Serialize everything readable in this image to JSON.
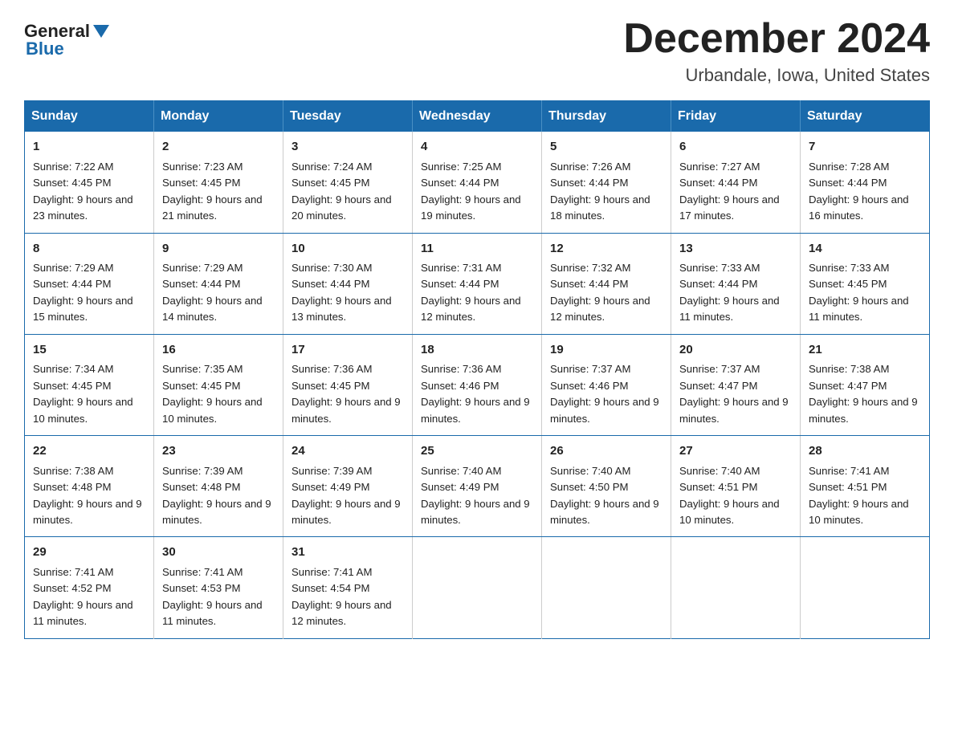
{
  "header": {
    "logo_general": "General",
    "logo_blue": "Blue",
    "month_title": "December 2024",
    "location": "Urbandale, Iowa, United States"
  },
  "calendar": {
    "days_of_week": [
      "Sunday",
      "Monday",
      "Tuesday",
      "Wednesday",
      "Thursday",
      "Friday",
      "Saturday"
    ],
    "weeks": [
      [
        {
          "day": "1",
          "sunrise": "7:22 AM",
          "sunset": "4:45 PM",
          "daylight": "9 hours and 23 minutes."
        },
        {
          "day": "2",
          "sunrise": "7:23 AM",
          "sunset": "4:45 PM",
          "daylight": "9 hours and 21 minutes."
        },
        {
          "day": "3",
          "sunrise": "7:24 AM",
          "sunset": "4:45 PM",
          "daylight": "9 hours and 20 minutes."
        },
        {
          "day": "4",
          "sunrise": "7:25 AM",
          "sunset": "4:44 PM",
          "daylight": "9 hours and 19 minutes."
        },
        {
          "day": "5",
          "sunrise": "7:26 AM",
          "sunset": "4:44 PM",
          "daylight": "9 hours and 18 minutes."
        },
        {
          "day": "6",
          "sunrise": "7:27 AM",
          "sunset": "4:44 PM",
          "daylight": "9 hours and 17 minutes."
        },
        {
          "day": "7",
          "sunrise": "7:28 AM",
          "sunset": "4:44 PM",
          "daylight": "9 hours and 16 minutes."
        }
      ],
      [
        {
          "day": "8",
          "sunrise": "7:29 AM",
          "sunset": "4:44 PM",
          "daylight": "9 hours and 15 minutes."
        },
        {
          "day": "9",
          "sunrise": "7:29 AM",
          "sunset": "4:44 PM",
          "daylight": "9 hours and 14 minutes."
        },
        {
          "day": "10",
          "sunrise": "7:30 AM",
          "sunset": "4:44 PM",
          "daylight": "9 hours and 13 minutes."
        },
        {
          "day": "11",
          "sunrise": "7:31 AM",
          "sunset": "4:44 PM",
          "daylight": "9 hours and 12 minutes."
        },
        {
          "day": "12",
          "sunrise": "7:32 AM",
          "sunset": "4:44 PM",
          "daylight": "9 hours and 12 minutes."
        },
        {
          "day": "13",
          "sunrise": "7:33 AM",
          "sunset": "4:44 PM",
          "daylight": "9 hours and 11 minutes."
        },
        {
          "day": "14",
          "sunrise": "7:33 AM",
          "sunset": "4:45 PM",
          "daylight": "9 hours and 11 minutes."
        }
      ],
      [
        {
          "day": "15",
          "sunrise": "7:34 AM",
          "sunset": "4:45 PM",
          "daylight": "9 hours and 10 minutes."
        },
        {
          "day": "16",
          "sunrise": "7:35 AM",
          "sunset": "4:45 PM",
          "daylight": "9 hours and 10 minutes."
        },
        {
          "day": "17",
          "sunrise": "7:36 AM",
          "sunset": "4:45 PM",
          "daylight": "9 hours and 9 minutes."
        },
        {
          "day": "18",
          "sunrise": "7:36 AM",
          "sunset": "4:46 PM",
          "daylight": "9 hours and 9 minutes."
        },
        {
          "day": "19",
          "sunrise": "7:37 AM",
          "sunset": "4:46 PM",
          "daylight": "9 hours and 9 minutes."
        },
        {
          "day": "20",
          "sunrise": "7:37 AM",
          "sunset": "4:47 PM",
          "daylight": "9 hours and 9 minutes."
        },
        {
          "day": "21",
          "sunrise": "7:38 AM",
          "sunset": "4:47 PM",
          "daylight": "9 hours and 9 minutes."
        }
      ],
      [
        {
          "day": "22",
          "sunrise": "7:38 AM",
          "sunset": "4:48 PM",
          "daylight": "9 hours and 9 minutes."
        },
        {
          "day": "23",
          "sunrise": "7:39 AM",
          "sunset": "4:48 PM",
          "daylight": "9 hours and 9 minutes."
        },
        {
          "day": "24",
          "sunrise": "7:39 AM",
          "sunset": "4:49 PM",
          "daylight": "9 hours and 9 minutes."
        },
        {
          "day": "25",
          "sunrise": "7:40 AM",
          "sunset": "4:49 PM",
          "daylight": "9 hours and 9 minutes."
        },
        {
          "day": "26",
          "sunrise": "7:40 AM",
          "sunset": "4:50 PM",
          "daylight": "9 hours and 9 minutes."
        },
        {
          "day": "27",
          "sunrise": "7:40 AM",
          "sunset": "4:51 PM",
          "daylight": "9 hours and 10 minutes."
        },
        {
          "day": "28",
          "sunrise": "7:41 AM",
          "sunset": "4:51 PM",
          "daylight": "9 hours and 10 minutes."
        }
      ],
      [
        {
          "day": "29",
          "sunrise": "7:41 AM",
          "sunset": "4:52 PM",
          "daylight": "9 hours and 11 minutes."
        },
        {
          "day": "30",
          "sunrise": "7:41 AM",
          "sunset": "4:53 PM",
          "daylight": "9 hours and 11 minutes."
        },
        {
          "day": "31",
          "sunrise": "7:41 AM",
          "sunset": "4:54 PM",
          "daylight": "9 hours and 12 minutes."
        },
        null,
        null,
        null,
        null
      ]
    ],
    "labels": {
      "sunrise": "Sunrise:",
      "sunset": "Sunset:",
      "daylight": "Daylight:"
    }
  }
}
